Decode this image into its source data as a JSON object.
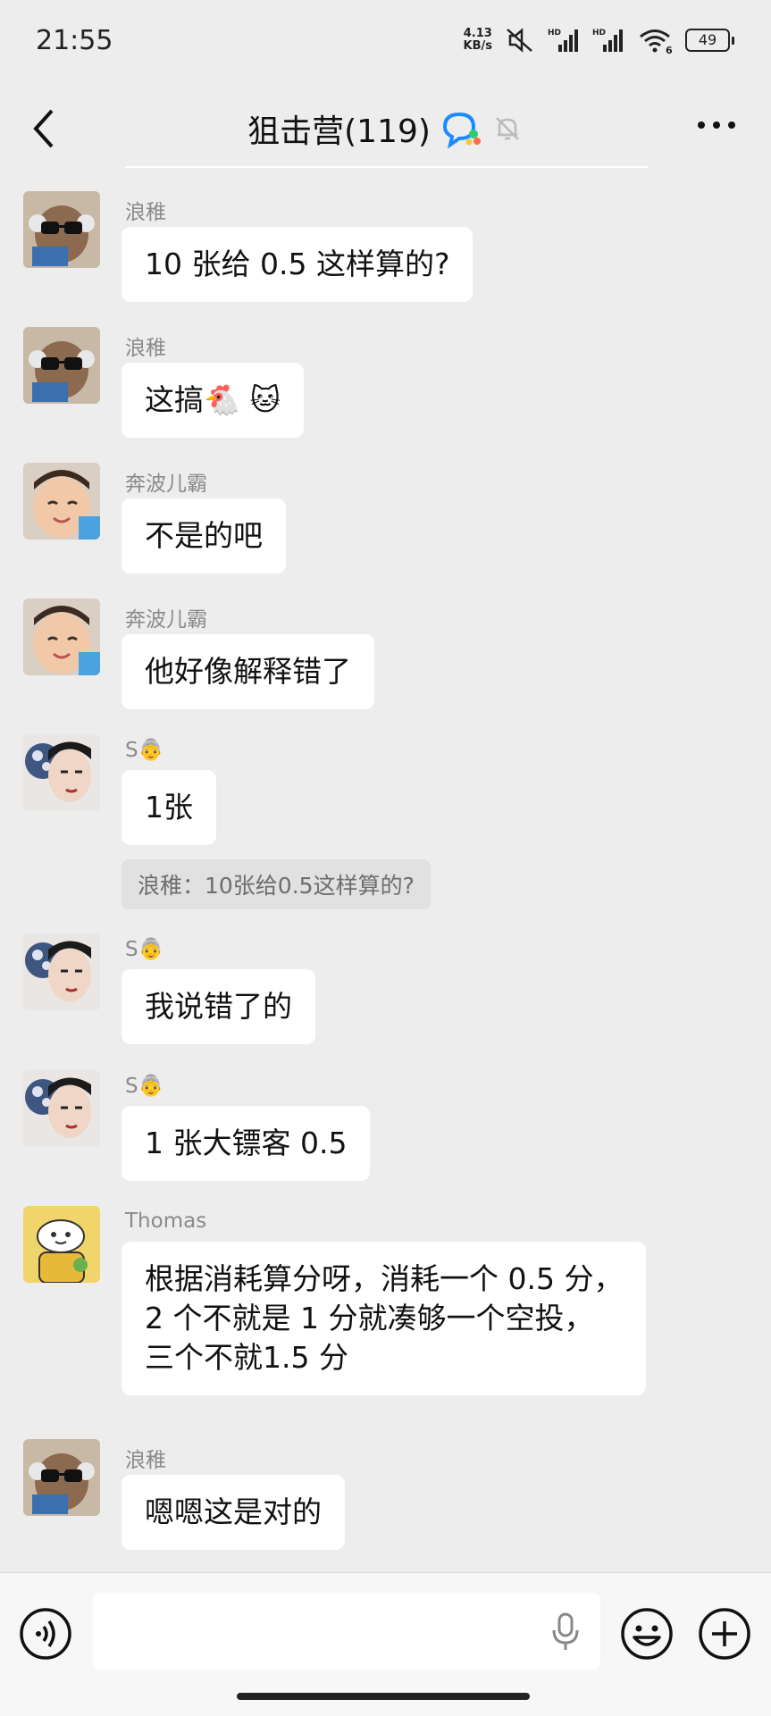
{
  "status_bar": {
    "time": "21:55",
    "net_speed_value": "4.13",
    "net_speed_unit": "KB/s",
    "battery": "49",
    "wifi_label": "6"
  },
  "header": {
    "title": "狙击营(119)",
    "back_icon": "chevron-left-icon",
    "more_icon": "more-horizontal-icon"
  },
  "messages": [
    {
      "sender": "浪稚",
      "text": "10 张给 0.5 这样算的?"
    },
    {
      "sender": "浪稚",
      "text": "这搞🐔 🐱"
    },
    {
      "sender": "奔波儿霸",
      "text": "不是的吧"
    },
    {
      "sender": "奔波儿霸",
      "text": "他好像解释错了"
    },
    {
      "sender": "S👵",
      "text": "1张",
      "quote": "浪稚：10张给0.5这样算的?"
    },
    {
      "sender": "S👵",
      "text": "我说错了的"
    },
    {
      "sender": "S👵",
      "text": "1 张大镖客 0.5"
    },
    {
      "sender": "Thomas",
      "text": "根据消耗算分呀，消耗一个 0.5 分，\n2 个不就是 1 分就凑够一个空投，\n三个不就1.5 分"
    },
    {
      "sender": "浪稚",
      "text": "嗯嗯这是对的"
    }
  ],
  "input": {
    "placeholder": "",
    "voice_icon": "voice-icon",
    "mic_icon": "microphone-icon",
    "emoji_icon": "emoji-icon",
    "plus_icon": "plus-icon"
  }
}
